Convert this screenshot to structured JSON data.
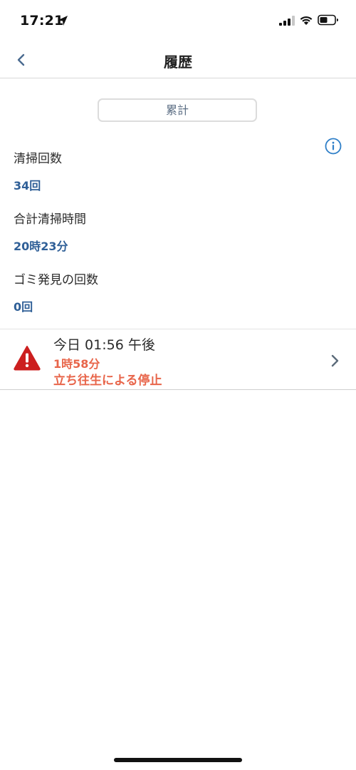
{
  "status_bar": {
    "time": "17:21"
  },
  "nav": {
    "title": "履歴"
  },
  "segment": {
    "label": "累計"
  },
  "stats": [
    {
      "label": "清掃回数",
      "value": "34回"
    },
    {
      "label": "合計清掃時間",
      "value": "20時23分"
    },
    {
      "label": "ゴミ発見の回数",
      "value": "0回"
    }
  ],
  "history": [
    {
      "date": "今日 01:56 午後",
      "duration": "1時58分",
      "error": "立ち往生による停止",
      "icon": "warning-icon"
    }
  ],
  "colors": {
    "accent_blue": "#2f5f97",
    "error_orange": "#e8654a",
    "warning_red": "#cc1f1f"
  }
}
